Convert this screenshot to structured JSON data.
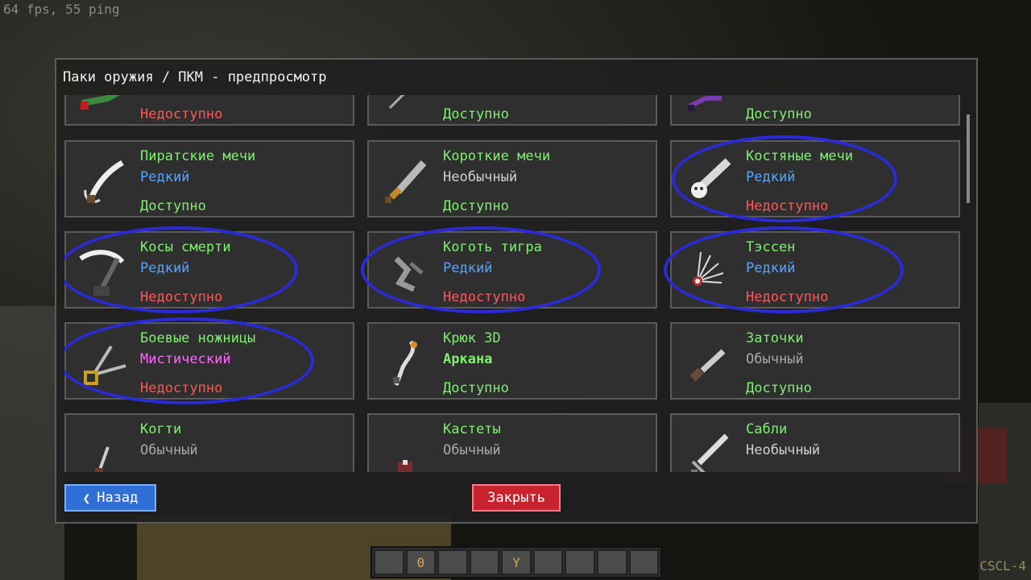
{
  "hud": {
    "fps_text": "64 fps, 55 ping",
    "corner_text": "CSCL-4"
  },
  "hotbar": {
    "slots": [
      "",
      "0",
      "",
      "",
      "Y",
      "",
      "",
      "",
      ""
    ]
  },
  "modal": {
    "title": "Паки оружия / ПКМ - предпросмотр",
    "back_label": "Назад",
    "close_label": "Закрыть",
    "colors": {
      "name": "#7ef06e",
      "available": "#7ef06e",
      "unavailable": "#ff5656",
      "rare": "#55a4ff",
      "uncommon": "#d0d0d0",
      "common": "#a8a8a8",
      "mythic": "#ff66ff",
      "arcane": "#7ef06e"
    },
    "cards": [
      {
        "name": "",
        "rarity": "",
        "rarity_color": "rare",
        "status": "Недоступно",
        "status_color": "unavailable",
        "icon": "green-weapon-icon",
        "circled": false
      },
      {
        "name": "",
        "rarity": "",
        "rarity_color": "rare",
        "status": "Доступно",
        "status_color": "available",
        "icon": "thin-blade-icon",
        "circled": false
      },
      {
        "name": "",
        "rarity": "",
        "rarity_color": "rare",
        "status": "Доступно",
        "status_color": "available",
        "icon": "purple-weapon-icon",
        "circled": false
      },
      {
        "name": "Пиратские мечи",
        "rarity": "Редкий",
        "rarity_color": "rare",
        "status": "Доступно",
        "status_color": "available",
        "icon": "pirate-sword-icon",
        "circled": false
      },
      {
        "name": "Короткие мечи",
        "rarity": "Необычный",
        "rarity_color": "uncommon",
        "status": "Доступно",
        "status_color": "available",
        "icon": "short-sword-icon",
        "circled": false
      },
      {
        "name": "Костяные мечи",
        "rarity": "Редкий",
        "rarity_color": "rare",
        "status": "Недоступно",
        "status_color": "unavailable",
        "icon": "bone-sword-icon",
        "circled": true
      },
      {
        "name": "Косы смерти",
        "rarity": "Редкий",
        "rarity_color": "rare",
        "status": "Недоступно",
        "status_color": "unavailable",
        "icon": "death-scythe-icon",
        "circled": true
      },
      {
        "name": "Коготь тигра",
        "rarity": "Редкий",
        "rarity_color": "rare",
        "status": "Недоступно",
        "status_color": "unavailable",
        "icon": "tiger-claw-icon",
        "circled": true
      },
      {
        "name": "Тэссен",
        "rarity": "Редкий",
        "rarity_color": "rare",
        "status": "Недоступно",
        "status_color": "unavailable",
        "icon": "tessen-fan-icon",
        "circled": true
      },
      {
        "name": "Боевые ножницы",
        "rarity": "Мистический",
        "rarity_color": "mythic",
        "status": "Недоступно",
        "status_color": "unavailable",
        "icon": "battle-scissors-icon",
        "circled": true
      },
      {
        "name": "Крюк 3D",
        "rarity": "Аркана",
        "rarity_color": "arcane",
        "status": "Доступно",
        "status_color": "available",
        "icon": "hook-icon",
        "circled": false
      },
      {
        "name": "Заточки",
        "rarity": "Обычный",
        "rarity_color": "common",
        "status": "Доступно",
        "status_color": "available",
        "icon": "shank-icon",
        "circled": false
      },
      {
        "name": "Когти",
        "rarity": "Обычный",
        "rarity_color": "common",
        "status": "",
        "status_color": "available",
        "icon": "claws-icon",
        "circled": false
      },
      {
        "name": "Кастеты",
        "rarity": "Обычный",
        "rarity_color": "common",
        "status": "",
        "status_color": "available",
        "icon": "brass-knuckles-icon",
        "circled": false
      },
      {
        "name": "Сабли",
        "rarity": "Необычный",
        "rarity_color": "uncommon",
        "status": "",
        "status_color": "available",
        "icon": "saber-icon",
        "circled": false
      }
    ]
  }
}
